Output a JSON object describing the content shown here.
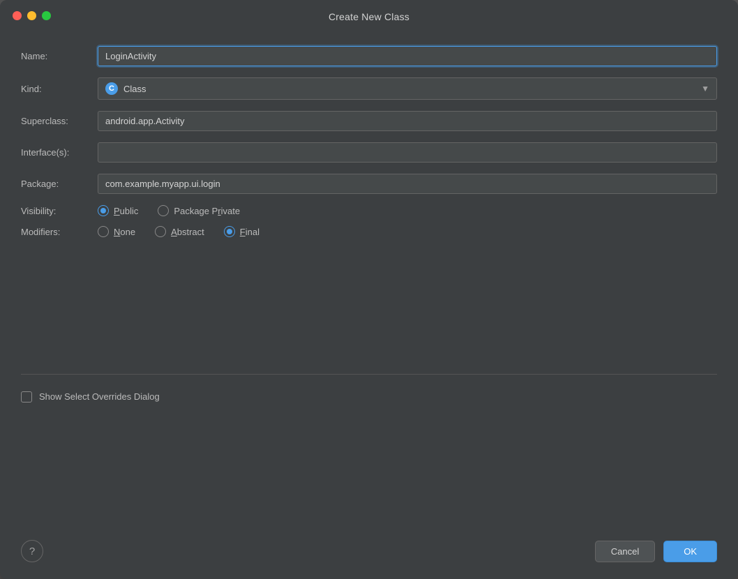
{
  "dialog": {
    "title": "Create New Class",
    "fields": {
      "name_label": "Name:",
      "name_value": "LoginActivity",
      "kind_label": "Kind:",
      "kind_value": "Class",
      "kind_icon": "C",
      "superclass_label": "Superclass:",
      "superclass_value": "android.app.Activity",
      "interfaces_label": "Interface(s):",
      "interfaces_value": "",
      "package_label": "Package:",
      "package_value": "com.example.myapp.ui.login"
    },
    "visibility": {
      "label": "Visibility:",
      "options": [
        {
          "id": "public",
          "label": "Public",
          "underline": "u",
          "checked": true
        },
        {
          "id": "package-private",
          "label": "Package Private",
          "underline": "R",
          "checked": false
        }
      ]
    },
    "modifiers": {
      "label": "Modifiers:",
      "options": [
        {
          "id": "none",
          "label": "None",
          "underline": "N",
          "checked": false
        },
        {
          "id": "abstract",
          "label": "Abstract",
          "underline": "A",
          "checked": false
        },
        {
          "id": "final",
          "label": "Final",
          "underline": "F",
          "checked": true
        }
      ]
    },
    "checkbox": {
      "label": "Show Select Overrides Dialog",
      "checked": false
    },
    "buttons": {
      "help": "?",
      "cancel": "Cancel",
      "ok": "OK"
    }
  }
}
